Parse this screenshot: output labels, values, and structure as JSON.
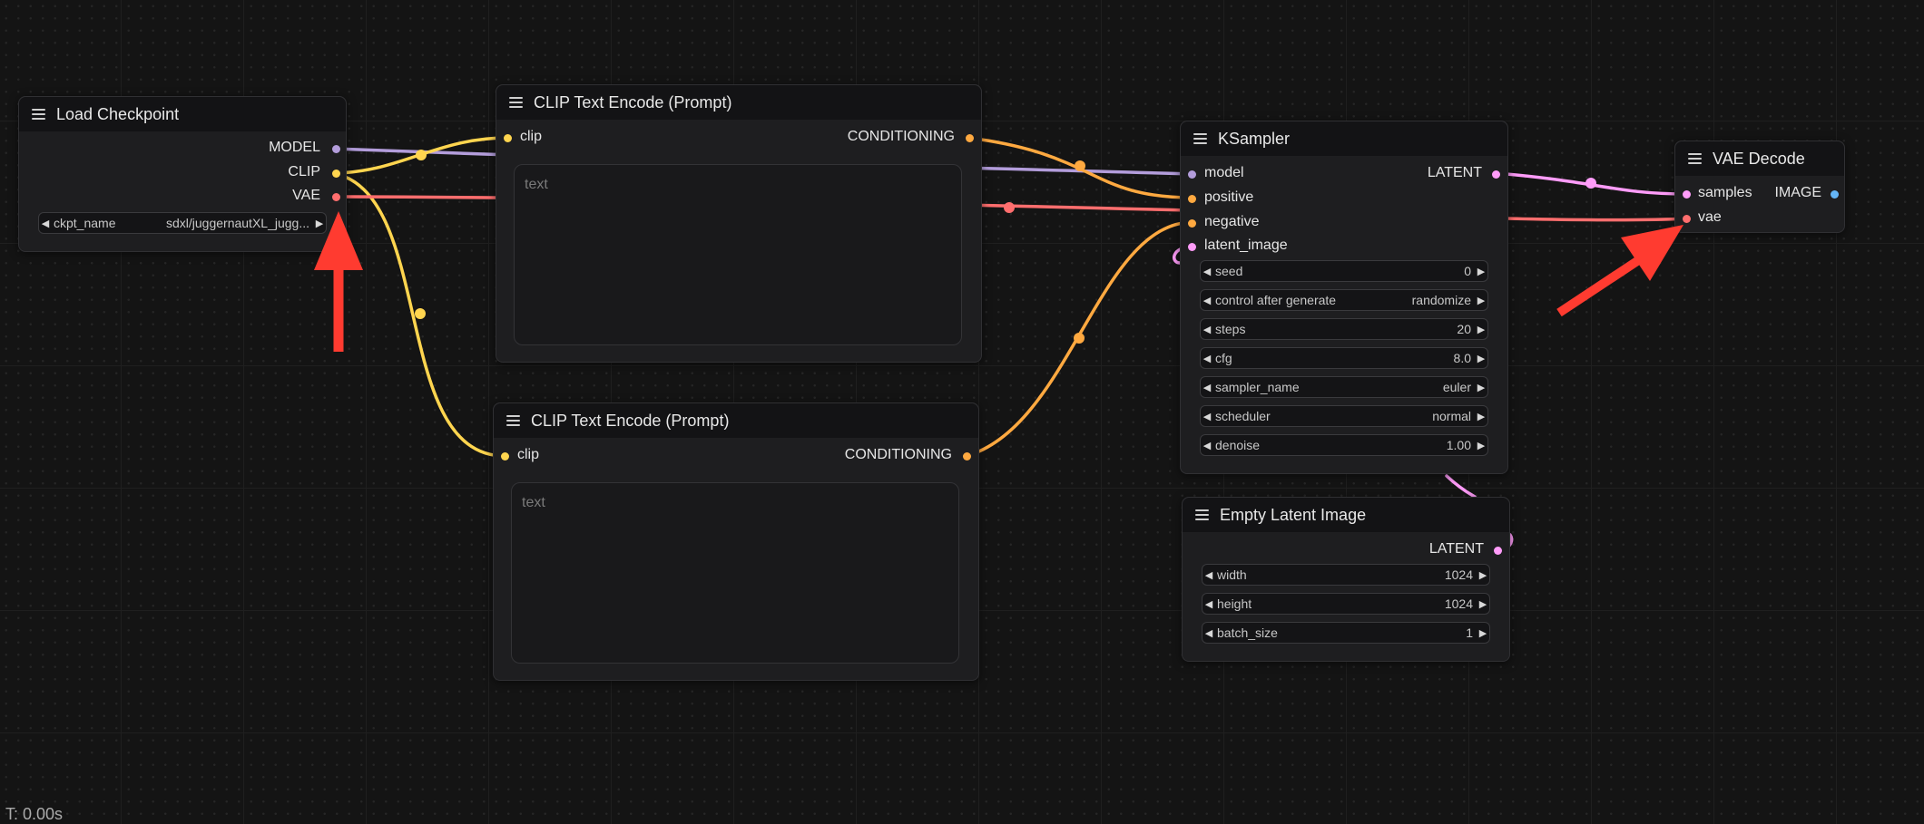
{
  "nodes": {
    "load_checkpoint": {
      "title": "Load Checkpoint",
      "outputs": [
        "MODEL",
        "CLIP",
        "VAE"
      ],
      "widget": {
        "label": "ckpt_name",
        "value": "sdxl/juggernautXL_jugg..."
      }
    },
    "clip_encode_1": {
      "title": "CLIP Text Encode (Prompt)",
      "input": "clip",
      "output": "CONDITIONING",
      "placeholder": "text"
    },
    "clip_encode_2": {
      "title": "CLIP Text Encode (Prompt)",
      "input": "clip",
      "output": "CONDITIONING",
      "placeholder": "text"
    },
    "ksampler": {
      "title": "KSampler",
      "inputs": [
        "model",
        "positive",
        "negative",
        "latent_image"
      ],
      "output": "LATENT",
      "widgets": [
        {
          "label": "seed",
          "value": "0"
        },
        {
          "label": "control after generate",
          "value": "randomize"
        },
        {
          "label": "steps",
          "value": "20"
        },
        {
          "label": "cfg",
          "value": "8.0"
        },
        {
          "label": "sampler_name",
          "value": "euler"
        },
        {
          "label": "scheduler",
          "value": "normal"
        },
        {
          "label": "denoise",
          "value": "1.00"
        }
      ]
    },
    "empty_latent": {
      "title": "Empty Latent Image",
      "output": "LATENT",
      "widgets": [
        {
          "label": "width",
          "value": "1024"
        },
        {
          "label": "height",
          "value": "1024"
        },
        {
          "label": "batch_size",
          "value": "1"
        }
      ]
    },
    "vae_decode": {
      "title": "VAE Decode",
      "inputs": [
        "samples",
        "vae"
      ],
      "output": "IMAGE"
    }
  },
  "colors": {
    "background": "#141414",
    "model": "#b39ddb",
    "clip": "#ffd54f",
    "vae": "#ff6e6e",
    "conditioning": "#ffa940",
    "latent": "#ff9cf9",
    "image": "#64b5f6",
    "annotation_arrow": "#ff3b30"
  },
  "status": "T: 0.00s"
}
